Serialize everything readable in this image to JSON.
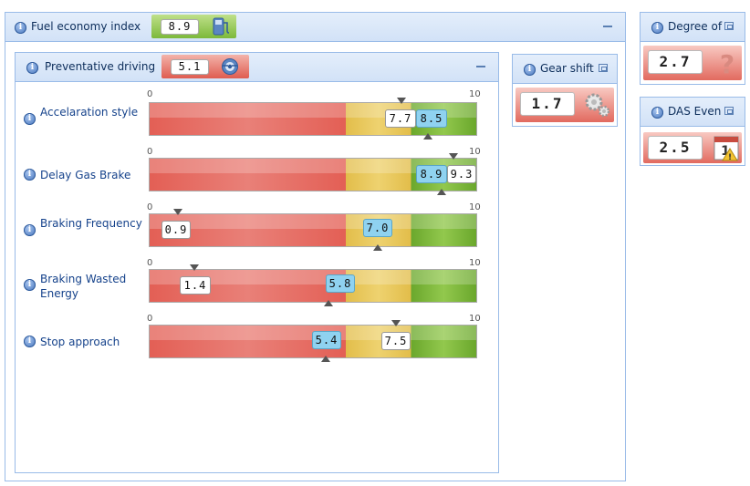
{
  "fuel_economy": {
    "title": "Fuel economy index",
    "value": "8.9",
    "icon": "fuel-pump-icon"
  },
  "preventative": {
    "title": "Preventative driving",
    "value": "5.1",
    "icon": "steering-wheel-icon"
  },
  "gear_shift": {
    "title": "Gear shift",
    "value": "1.7",
    "icon": "gears-icon"
  },
  "degree_of": {
    "title": "Degree of",
    "value": "2.7",
    "icon": "question-mark-icon"
  },
  "das_events": {
    "title": "DAS Even",
    "value": "2.5",
    "icon": "calendar-warning-icon"
  },
  "scale": {
    "min": "0",
    "max": "10"
  },
  "rows": [
    {
      "label": "Accelaration style",
      "top_value": "7.7",
      "bottom_value": "8.5"
    },
    {
      "label": "Delay Gas Brake",
      "top_value": "9.3",
      "bottom_value": "8.9"
    },
    {
      "label": "Braking Frequency",
      "top_value": "0.9",
      "bottom_value": "7.0"
    },
    {
      "label": "Braking Wasted Energy",
      "top_value": "1.4",
      "bottom_value": "5.8"
    },
    {
      "label": "Stop approach",
      "top_value": "7.5",
      "bottom_value": "5.4"
    }
  ],
  "colors": {
    "header_bg": "#dfe8f6",
    "border": "#99bbe8",
    "bad": "#e35f55",
    "medium": "#e2bd4a",
    "good": "#7ab434",
    "target": "#8fd2f0"
  }
}
